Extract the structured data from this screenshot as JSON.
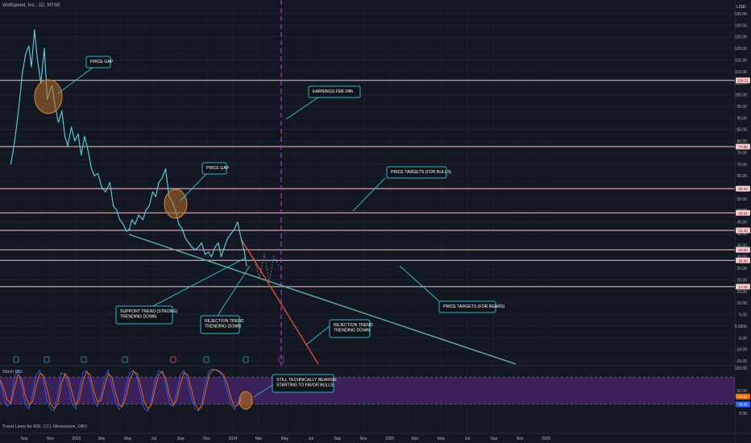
{
  "header": {
    "title": "Wolfspeed, Inc., 1D, NYSE",
    "currency": "USD"
  },
  "chart_data": [
    {
      "type": "line",
      "title": "Wolfspeed, Inc., 1D, NYSE",
      "yaxis_ticks": [
        "135.00",
        "130.00",
        "125.00",
        "120.00",
        "115.00",
        "110.00",
        "105.00",
        "100.00",
        "95.00",
        "90.00",
        "85.00",
        "80.00",
        "75.00",
        "70.00",
        "65.00",
        "60.00",
        "55.00",
        "50.00",
        "45.00",
        "40.00",
        "35.00",
        "30.00",
        "25.00",
        "20.00",
        "15.00",
        "10.00",
        "5.00",
        "0.0000",
        "-5.00",
        "-10.00",
        "-15.00"
      ],
      "xaxis_ticks": [
        "Sep",
        "Nov",
        "2023",
        "Mar",
        "May",
        "Jul",
        "Sep",
        "Nov",
        "2024",
        "Mar",
        "May",
        "Jul",
        "Sep",
        "Nov",
        "2025",
        "Mar",
        "May",
        "Jul",
        "Sep",
        "Nov",
        "2026"
      ],
      "ylim": [
        -17,
        136
      ],
      "price_series": {
        "name": "WOLF",
        "x": [
          "2022-08-01",
          "2022-08-10",
          "2022-08-20",
          "2022-08-28",
          "2022-09-05",
          "2022-09-12",
          "2022-09-18",
          "2022-09-25",
          "2022-10-02",
          "2022-10-10",
          "2022-10-18",
          "2022-10-25",
          "2022-11-01",
          "2022-11-05",
          "2022-11-12",
          "2022-11-20",
          "2022-11-28",
          "2022-12-05",
          "2022-12-12",
          "2022-12-20",
          "2022-12-28",
          "2023-01-05",
          "2023-01-12",
          "2023-01-20",
          "2023-01-28",
          "2023-02-05",
          "2023-02-12",
          "2023-02-20",
          "2023-03-01",
          "2023-03-10",
          "2023-03-20",
          "2023-03-28",
          "2023-04-05",
          "2023-04-12",
          "2023-04-20",
          "2023-04-28",
          "2023-05-05",
          "2023-05-10",
          "2023-05-18",
          "2023-05-26",
          "2023-06-05",
          "2023-06-12",
          "2023-06-20",
          "2023-06-28",
          "2023-07-05",
          "2023-07-12",
          "2023-07-20",
          "2023-07-28",
          "2023-08-05",
          "2023-08-12",
          "2023-08-20",
          "2023-08-28",
          "2023-09-05",
          "2023-09-12",
          "2023-09-20",
          "2023-09-28",
          "2023-10-05",
          "2023-10-12",
          "2023-10-20",
          "2023-10-28",
          "2023-11-05",
          "2023-11-12",
          "2023-11-20",
          "2023-11-28",
          "2023-12-05",
          "2023-12-12",
          "2023-12-20",
          "2023-12-28",
          "2024-01-05",
          "2024-01-12",
          "2024-01-20",
          "2024-01-28",
          "2024-02-02"
        ],
        "y": [
          70,
          80,
          95,
          110,
          118,
          121,
          112,
          128,
          115,
          105,
          120,
          98,
          102,
          104,
          95,
          88,
          93,
          82,
          78,
          86,
          80,
          83,
          74,
          82,
          76,
          68,
          65,
          66,
          60,
          58,
          62,
          52,
          50,
          46,
          44,
          41,
          42,
          46,
          44,
          48,
          46,
          50,
          52,
          58,
          56,
          62,
          64,
          68,
          56,
          54,
          50,
          44,
          42,
          38,
          36,
          34,
          33,
          34,
          36,
          31,
          32,
          30,
          34,
          36,
          30,
          34,
          38,
          40,
          42,
          45,
          38,
          32,
          26
        ]
      },
      "horizontal_levels": [
        106.21,
        77.58,
        59.4,
        48.94,
        41.4,
        33.0,
        28.4,
        17.06
      ],
      "price_axis_tags": [
        "106.21",
        "77.58",
        "59.40",
        "48.94",
        "41.40",
        "33.00",
        "28.40",
        "17.06"
      ],
      "annotations": [
        "PRICE GAP",
        "PRICE GAP",
        "EARNINGS FEB 24th",
        "PRICE TARGETS (FOR BULLS)",
        "PRICE TARGETS (FOR BEARS)",
        "SUPPORT TREND (STRONG) TRENDING DOWN",
        "REJECTION TREND TRENDING DOWN",
        "REJECTION TREND TRENDING DOWN",
        "STILL TECHNICALLY BEARISH STARTING TO FAVOR BULLS"
      ],
      "event_markers": [
        "green",
        "green",
        "green",
        "green",
        "red",
        "green",
        "green",
        "green",
        "purple"
      ],
      "colors": {
        "background": "#131722",
        "price": "#5fd3e0",
        "levels": "#f3c9c9",
        "support_trend": "#5fb3a4",
        "rejection_trend": "#e04a3a",
        "earnings_line": "#b72fd0",
        "annotation_box": "#10131a",
        "annotation_border": "#2fb6c8"
      },
      "grid": true
    },
    {
      "type": "line",
      "title": "Stoch RSI",
      "ylim": [
        0,
        100
      ],
      "yaxis_ticks": [
        "100.00",
        "50.00",
        "0.00"
      ],
      "value_tags": [
        "38.34",
        "33.46"
      ],
      "band": [
        20,
        80
      ],
      "series": [
        {
          "name": "K",
          "color": "#2962ff",
          "values": [
            70,
            40,
            15,
            25,
            80,
            95,
            60,
            20,
            10,
            40,
            85,
            95,
            75,
            30,
            10,
            5,
            40,
            90,
            85,
            60,
            20,
            10,
            50,
            90,
            95,
            70,
            30,
            15,
            40,
            80,
            95,
            60,
            25,
            8,
            20,
            60,
            90,
            95,
            80,
            40,
            10,
            5,
            30,
            75,
            95,
            90,
            60,
            20,
            15,
            45,
            85,
            95,
            70,
            35,
            10,
            5,
            25,
            70,
            95,
            98,
            95,
            90,
            80,
            50,
            20,
            8,
            25,
            38
          ]
        },
        {
          "name": "D",
          "color": "#ff6d00",
          "values": [
            75,
            55,
            30,
            22,
            55,
            85,
            75,
            40,
            18,
            25,
            60,
            88,
            85,
            55,
            22,
            10,
            20,
            65,
            88,
            75,
            45,
            18,
            30,
            70,
            92,
            85,
            50,
            25,
            28,
            60,
            88,
            80,
            45,
            18,
            15,
            40,
            75,
            92,
            88,
            60,
            25,
            10,
            18,
            55,
            85,
            93,
            75,
            40,
            18,
            30,
            65,
            90,
            85,
            55,
            22,
            8,
            15,
            50,
            85,
            96,
            96,
            92,
            85,
            65,
            35,
            15,
            18,
            33
          ]
        }
      ]
    }
  ],
  "rsi_panel": {
    "label": "Stoch RSI"
  },
  "footer": {
    "note": "Trend Lines for RSI, CCI, Momentum, OBV"
  }
}
